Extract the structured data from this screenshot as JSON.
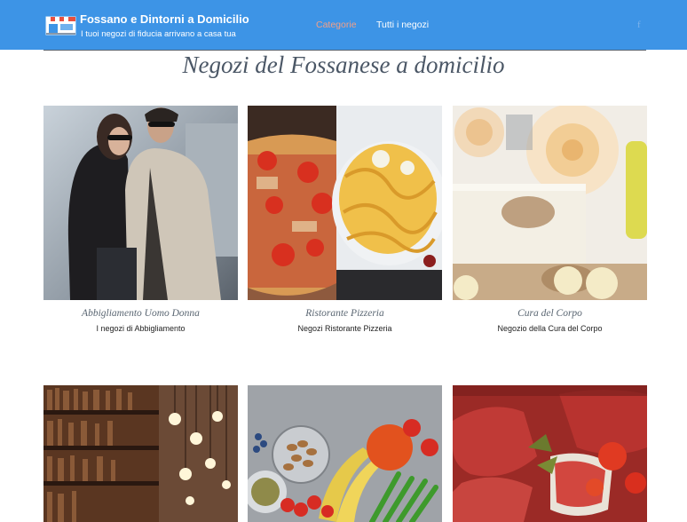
{
  "header": {
    "title": "Fossano e Dintorni a Domicilio",
    "subtitle": "I tuoi negozi di fiducia arrivano a casa tua",
    "nav": [
      "Categorie",
      "Tutti i negozi"
    ],
    "social": "f",
    "colors": {
      "bar": "#3d94e6",
      "active_nav": "#f2a088"
    }
  },
  "main": {
    "title": "Negozi del Fossanese a domicilio",
    "categories": [
      {
        "title": "Abbigliamento Uomo Donna",
        "desc": "I negozi di Abbigliamento"
      },
      {
        "title": "Ristorante Pizzeria",
        "desc": "Negozi Ristorante Pizzeria"
      },
      {
        "title": "Cura del Corpo",
        "desc": "Negozio della Cura del Corpo"
      }
    ]
  }
}
